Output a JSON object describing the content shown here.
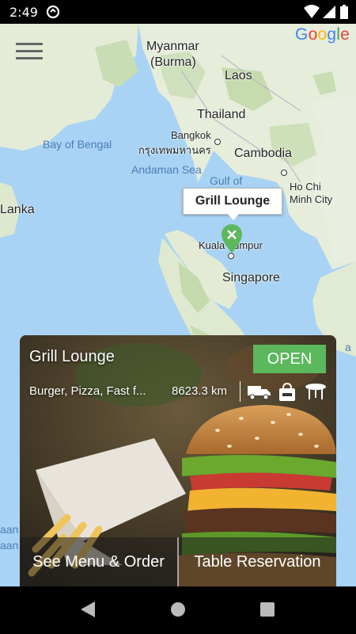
{
  "status_bar": {
    "time": "2:49"
  },
  "map": {
    "provider_logo": "Google",
    "labels": {
      "myanmar": "Myanmar",
      "burma": "(Burma)",
      "laos": "Laos",
      "thailand": "Thailand",
      "bangkok": "Bangkok",
      "bangkok_thai": "กรุงเทพมหานคร",
      "cambodia": "Cambodia",
      "bay_of_bengal": "Bay of Bengal",
      "andaman_sea": "Andaman Sea",
      "gulf_of": "Gulf of",
      "ho_chi": "Ho Chi",
      "minh_city": "Minh City",
      "lanka": "Lanka",
      "kuala_lumpur": "Kuala Lumpur",
      "singapore": "Singapore",
      "edge_aan1": "aan",
      "edge_aan2": "aan",
      "edge_ea": "a"
    },
    "marker_callout": "Grill Lounge"
  },
  "restaurant_card": {
    "name": "Grill Lounge",
    "status": "OPEN",
    "categories": "Burger, Pizza, Fast f...",
    "distance": "8623.3 km",
    "service_icons": [
      "delivery-truck-icon",
      "takeaway-bag-icon",
      "dine-in-table-icon"
    ],
    "actions": {
      "menu_order": "See Menu & Order",
      "table_reservation": "Table Reservation"
    }
  },
  "colors": {
    "open_badge": "#5cb85c",
    "map_water": "#a8d3f4",
    "map_land": "#e8efe0"
  }
}
